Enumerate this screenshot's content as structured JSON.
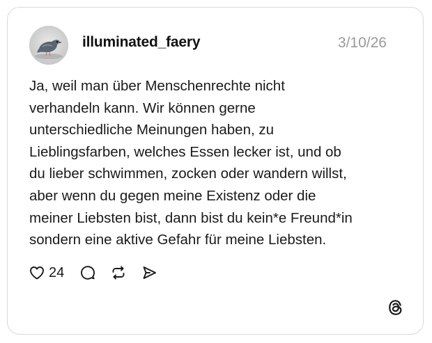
{
  "post": {
    "author": {
      "username": "illuminated_faery",
      "avatar_icon": "pigeon-avatar"
    },
    "date": "3/10/26",
    "text_lines": [
      "Ja, weil man über Menschenrechte nicht",
      "verhandeln kann. Wir können gerne",
      "unterschiedliche Meinungen haben, zu",
      "Lieblingsfarben, welches Essen lecker ist, und ob",
      "du lieber schwimmen, zocken oder wandern willst,",
      "aber wenn du gegen meine Existenz oder die",
      "meiner Liebsten bist, dann bist du kein*e Freund*in",
      "sondern eine aktive Gefahr für meine Liebsten."
    ],
    "actions": {
      "like_count": "24",
      "like_icon": "heart-icon",
      "reply_icon": "comment-icon",
      "repost_icon": "repost-icon",
      "share_icon": "send-icon"
    },
    "brand_icon": "threads-logo-icon"
  },
  "colors": {
    "text": "#1a1a1a",
    "muted": "#9a9a9a",
    "border": "#d9d9d9"
  }
}
